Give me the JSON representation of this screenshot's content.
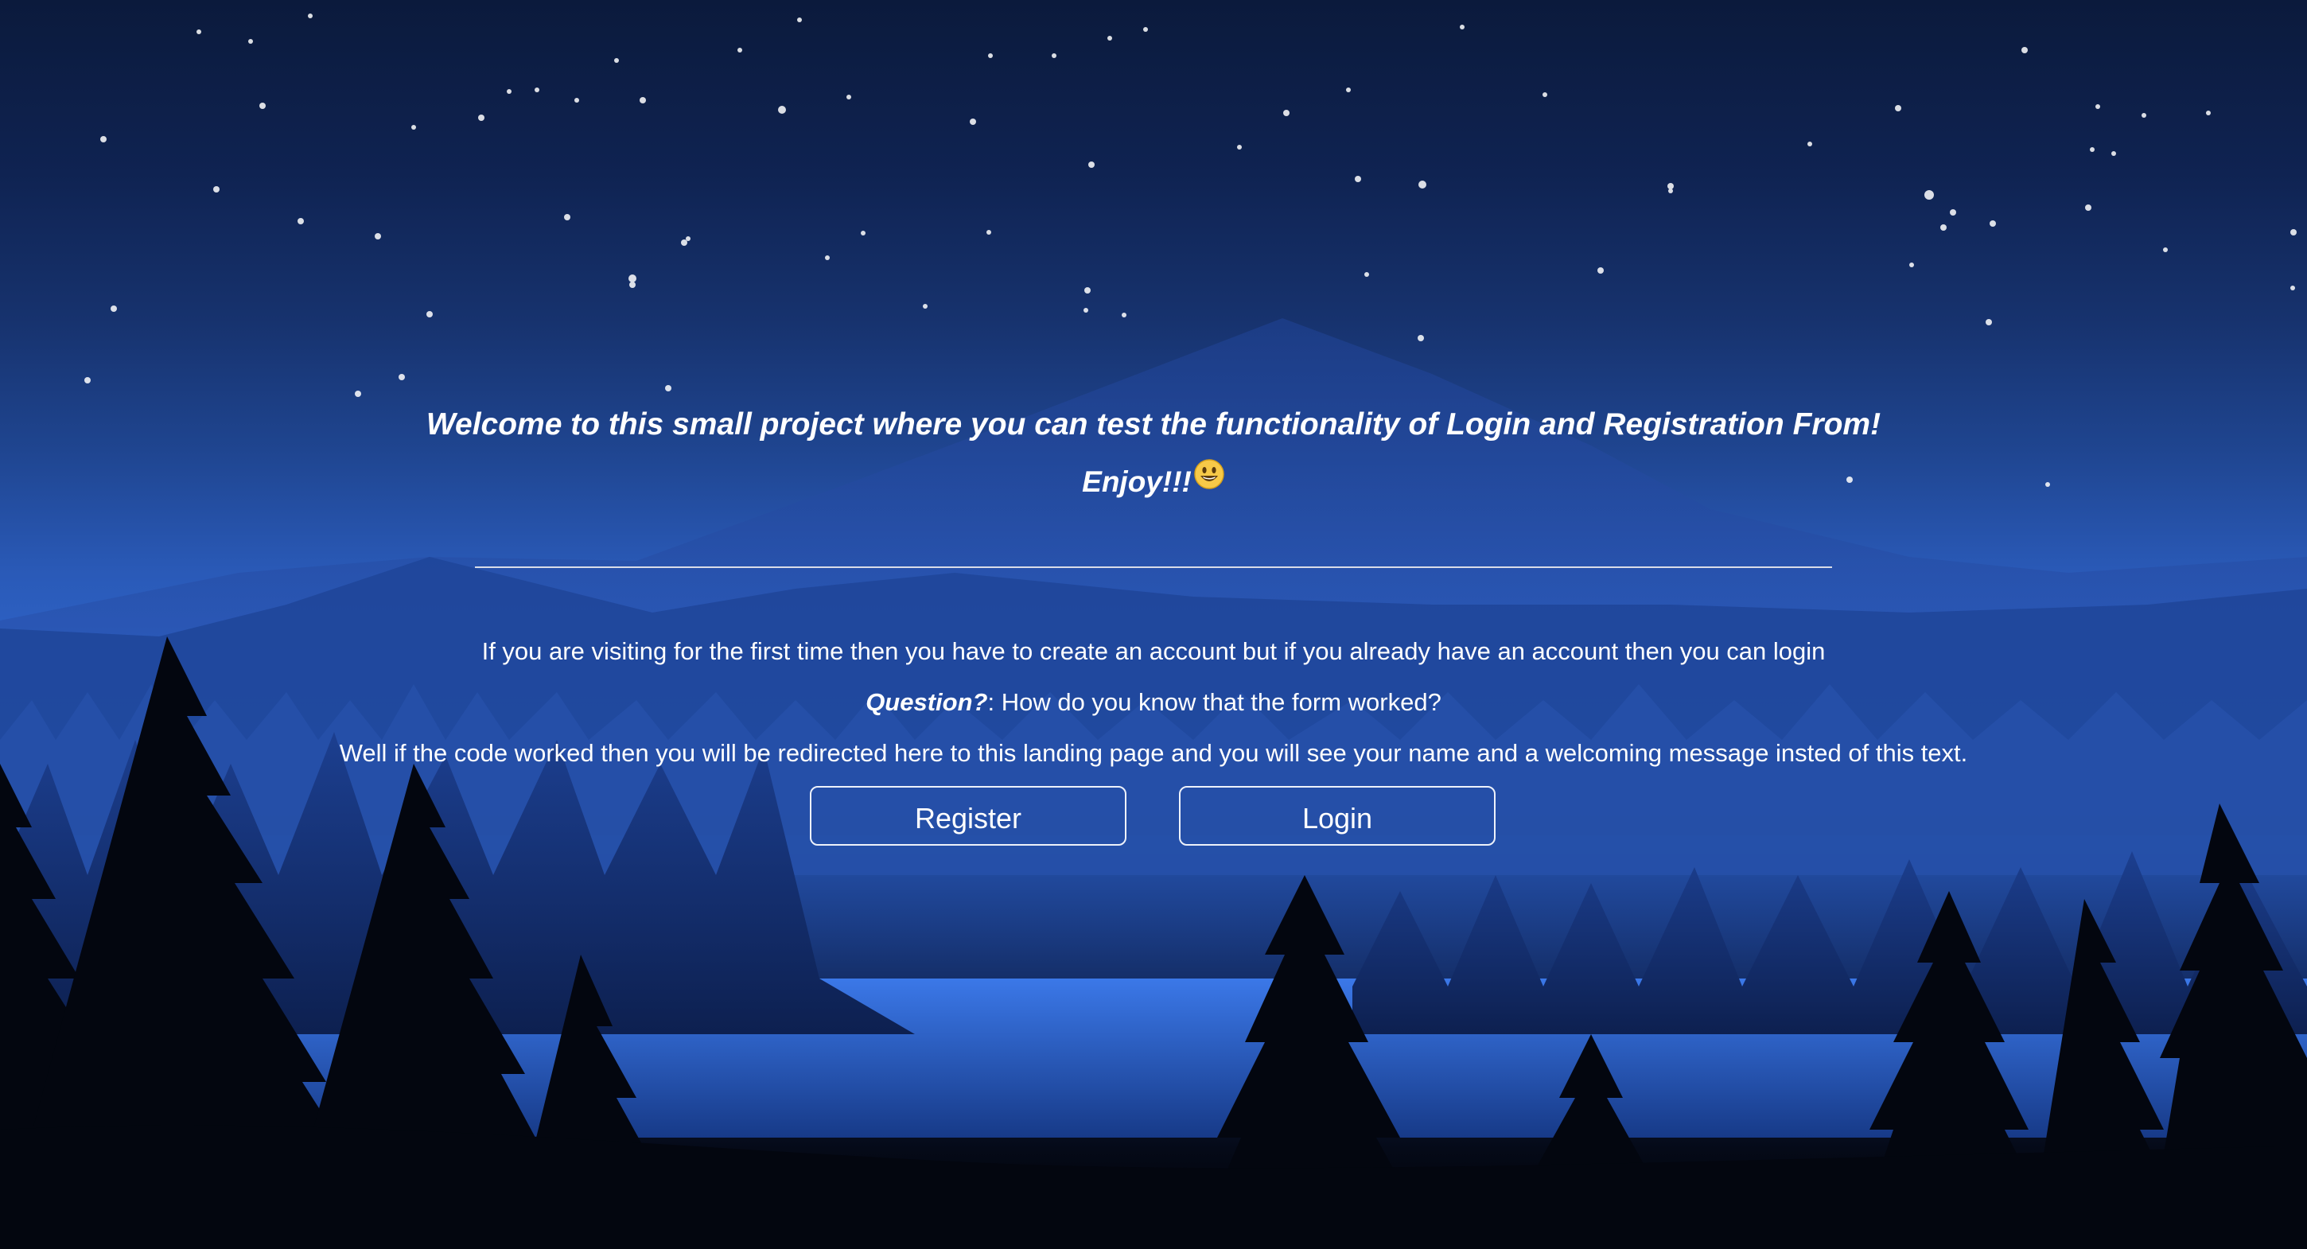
{
  "hero": {
    "welcome_text": "Welcome to this small project where you can test the functionality of Login and Registration From!",
    "enjoy_text": "Enjoy!!!"
  },
  "info": {
    "line1": "If you are visiting for the first time then you have to create an account but if you already have an account then you can login",
    "question_label": "Question?",
    "question_text": ": How do you know that the form worked?",
    "line3": "Well if the code worked then you will be redirected here to this landing page and you will see your name and a welcoming message insted of this text."
  },
  "buttons": {
    "register_label": "Register",
    "login_label": "Login"
  },
  "icons": {
    "enjoy_emoji": "smiling-face-icon"
  },
  "colors": {
    "text": "#ffffff",
    "sky_top": "#0b1a3c",
    "sky_mid": "#2f66cc",
    "forest": "#000000"
  }
}
